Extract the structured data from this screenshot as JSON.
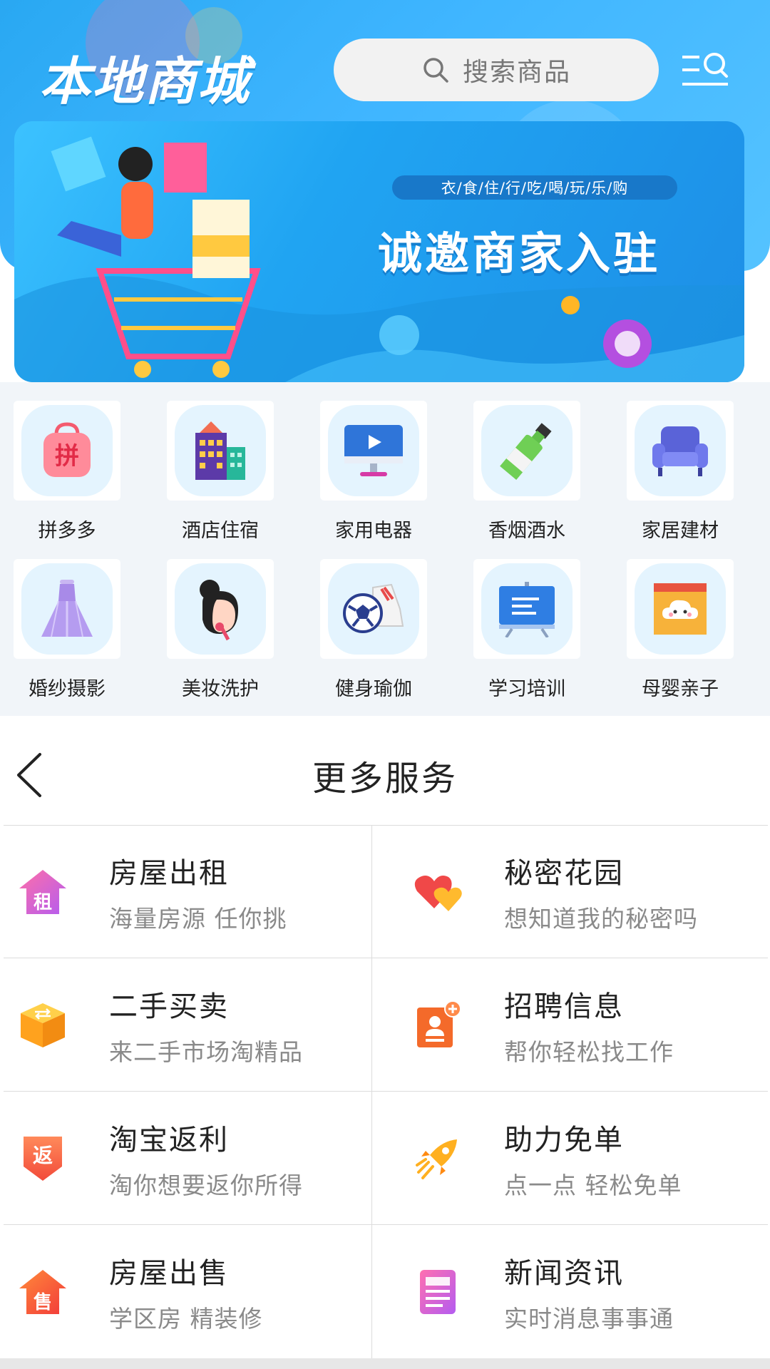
{
  "header": {
    "title": "本地商城",
    "search_placeholder": "搜索商品"
  },
  "banner": {
    "tagline": "衣/食/住/行/吃/喝/玩/乐/购",
    "headline": "诚邀商家入驻"
  },
  "categories": [
    {
      "label": "拼多多",
      "icon": "pinduoduo-bag-icon",
      "glyph": "拼"
    },
    {
      "label": "酒店住宿",
      "icon": "hotel-building-icon"
    },
    {
      "label": "家用电器",
      "icon": "monitor-icon"
    },
    {
      "label": "香烟酒水",
      "icon": "bottle-icon"
    },
    {
      "label": "家居建材",
      "icon": "sofa-icon"
    },
    {
      "label": "婚纱摄影",
      "icon": "wedding-dress-icon"
    },
    {
      "label": "美妆洗护",
      "icon": "woman-face-icon"
    },
    {
      "label": "健身瑜伽",
      "icon": "soccer-shoe-icon"
    },
    {
      "label": "学习培训",
      "icon": "blackboard-icon"
    },
    {
      "label": "母婴亲子",
      "icon": "baby-frame-icon"
    }
  ],
  "more_services": {
    "title": "更多服务",
    "items": [
      {
        "title": "房屋出租",
        "subtitle": "海量房源 任你挑",
        "icon": "rent-house-icon",
        "glyph": "租"
      },
      {
        "title": "秘密花园",
        "subtitle": "想知道我的秘密吗",
        "icon": "hearts-icon"
      },
      {
        "title": "二手买卖",
        "subtitle": "来二手市场淘精品",
        "icon": "box-exchange-icon"
      },
      {
        "title": "招聘信息",
        "subtitle": "帮你轻松找工作",
        "icon": "resume-add-icon"
      },
      {
        "title": "淘宝返利",
        "subtitle": "淘你想要返你所得",
        "icon": "rebate-arrow-icon",
        "glyph": "返"
      },
      {
        "title": "助力免单",
        "subtitle": "点一点 轻松免单",
        "icon": "rocket-icon"
      },
      {
        "title": "房屋出售",
        "subtitle": "学区房 精装修",
        "icon": "sale-house-icon",
        "glyph": "售"
      },
      {
        "title": "新闻资讯",
        "subtitle": "实时消息事事通",
        "icon": "news-doc-icon"
      }
    ]
  },
  "colors": {
    "header_blue": "#3fb5ff",
    "icon_tile_bg": "#e4f4fe",
    "subtitle_gray": "#8a8a8a"
  }
}
